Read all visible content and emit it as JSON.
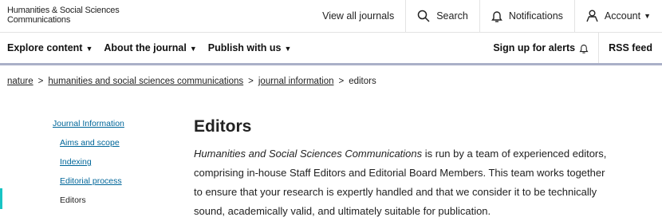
{
  "header": {
    "brand_line1": "Humanities & Social Sciences",
    "brand_line2": "Communications",
    "view_all": "View all journals",
    "search": "Search",
    "notifications": "Notifications",
    "account": "Account"
  },
  "menu": {
    "explore": "Explore content",
    "about": "About the journal",
    "publish": "Publish with us",
    "alerts": "Sign up for alerts",
    "rss": "RSS feed"
  },
  "breadcrumb": [
    "nature",
    "humanities and social sciences communications",
    "journal information",
    "editors"
  ],
  "sidebar": {
    "items": [
      {
        "label": "Journal Information"
      },
      {
        "label": "Aims and scope"
      },
      {
        "label": "Indexing"
      },
      {
        "label": "Editorial process"
      },
      {
        "label": "Editors"
      }
    ]
  },
  "main": {
    "title": "Editors",
    "intro_italic": "Humanities and Social Sciences Communications",
    "intro_rest": " is run by a team of experienced editors, comprising in-house Staff Editors and Editorial Board Members. This team works together to ensure that your research is expertly handled and that we consider it to be technically sound, academically valid, and ultimately suitable for publication."
  },
  "colors": {
    "link": "#006699",
    "accent": "#18c4c4",
    "rule": "#aab0c8"
  }
}
